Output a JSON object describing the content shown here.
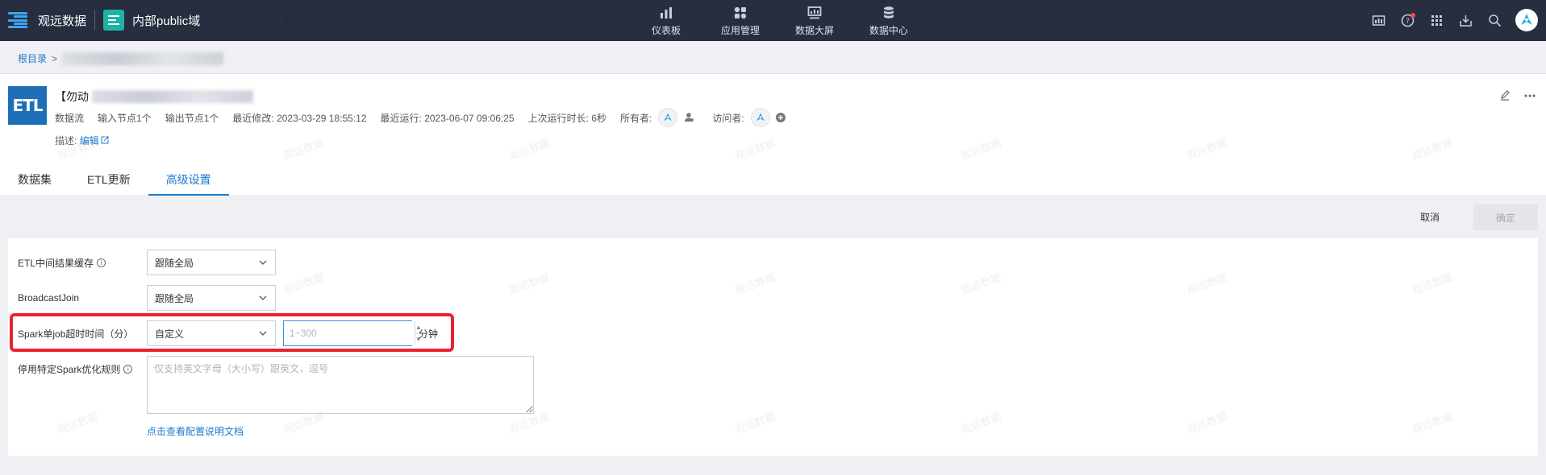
{
  "topbar": {
    "brand_name": "观远数据",
    "domain_name": "内部public域",
    "nav": [
      {
        "label": "仪表板",
        "icon": "bar-chart-icon"
      },
      {
        "label": "应用管理",
        "icon": "app-grid-icon"
      },
      {
        "label": "数据大屏",
        "icon": "screen-icon"
      },
      {
        "label": "数据中心",
        "icon": "database-icon"
      }
    ],
    "tools": [
      "report-icon",
      "help-icon",
      "apps-icon",
      "download-icon",
      "search-icon"
    ]
  },
  "breadcrumb": {
    "root": "根目录",
    "sep": ">"
  },
  "etl": {
    "logo": "ETL",
    "title_prefix": "【勿动",
    "type": "数据流",
    "inputs": "输入节点1个",
    "outputs": "输出节点1个",
    "last_modified_label": "最近修改:",
    "last_modified": "2023-03-29 18:55:12",
    "last_run_label": "最近运行:",
    "last_run": "2023-06-07 09:06:25",
    "duration": "上次运行时长: 6秒",
    "owner_label": "所有者:",
    "visitor_label": "访问者:",
    "desc_label": "描述:",
    "edit_label": "编辑"
  },
  "tabs": [
    {
      "label": "数据集",
      "active": false
    },
    {
      "label": "ETL更新",
      "active": false
    },
    {
      "label": "高级设置",
      "active": true
    }
  ],
  "actions": {
    "cancel": "取消",
    "confirm": "确定"
  },
  "form": {
    "cache_label": "ETL中间结果缓存",
    "cache_value": "跟随全局",
    "broadcast_label": "BroadcastJoin",
    "broadcast_value": "跟随全局",
    "timeout_label": "Spark单job超时时间（分）",
    "timeout_mode": "自定义",
    "timeout_placeholder": "1~300",
    "timeout_unit": "分钟",
    "rules_label": "停用特定Spark优化规则",
    "rules_placeholder": "仅支持英文字母（大小写）跟英文，逗号",
    "doc_link": "点击查看配置说明文档"
  },
  "watermark": "观远数据",
  "colors": {
    "topbar": "#262e3f",
    "accent": "#1e7ad1",
    "highlight": "#e8232f",
    "logo": "#1e6fb7"
  }
}
